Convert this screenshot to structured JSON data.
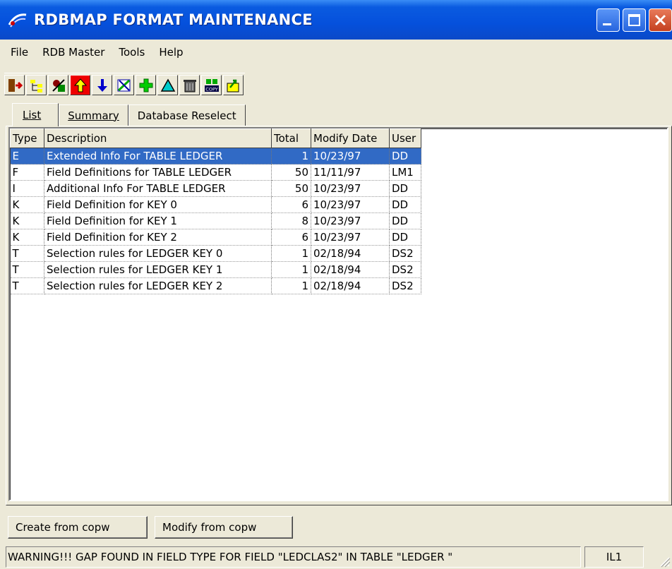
{
  "window": {
    "title": "RDBMAP FORMAT MAINTENANCE"
  },
  "menu": [
    "File",
    "RDB Master",
    "Tools",
    "Help"
  ],
  "toolbar": {
    "icons": [
      "exit-icon",
      "tree-icon",
      "wizard-icon",
      "move-up-icon",
      "move-down-icon",
      "edit-icon",
      "add-icon",
      "triangle-icon",
      "trash-icon",
      "copy-icon",
      "export-icon"
    ],
    "copy_label": "COPY"
  },
  "tabs": [
    {
      "label": "List",
      "active": true
    },
    {
      "label": "Summary",
      "active": false
    },
    {
      "label": "Database Reselect",
      "active": false
    }
  ],
  "table": {
    "columns": [
      "Type",
      "Description",
      "Total",
      "Modify Date",
      "User"
    ],
    "rows": [
      {
        "type": "E",
        "description": "Extended Info For TABLE LEDGER",
        "total": "1",
        "date": "10/23/97",
        "user": "DD",
        "selected": true
      },
      {
        "type": "F",
        "description": "Field Definitions for TABLE LEDGER",
        "total": "50",
        "date": "11/11/97",
        "user": "LM1"
      },
      {
        "type": "I",
        "description": "Additional Info For TABLE LEDGER",
        "total": "50",
        "date": "10/23/97",
        "user": "DD"
      },
      {
        "type": "K",
        "description": "Field Definition for KEY 0",
        "total": "6",
        "date": "10/23/97",
        "user": "DD"
      },
      {
        "type": "K",
        "description": "Field Definition for KEY 1",
        "total": "8",
        "date": "10/23/97",
        "user": "DD"
      },
      {
        "type": "K",
        "description": "Field Definition for KEY 2",
        "total": "6",
        "date": "10/23/97",
        "user": "DD"
      },
      {
        "type": "T",
        "description": "Selection rules for LEDGER   KEY 0",
        "total": "1",
        "date": "02/18/94",
        "user": "DS2"
      },
      {
        "type": "T",
        "description": "Selection rules for LEDGER   KEY 1",
        "total": "1",
        "date": "02/18/94",
        "user": "DS2"
      },
      {
        "type": "T",
        "description": "Selection rules for LEDGER   KEY 2",
        "total": "1",
        "date": "02/18/94",
        "user": "DS2"
      }
    ]
  },
  "buttons": {
    "create": "Create from copw",
    "modify": "Modify from copw"
  },
  "status": {
    "message": "WARNING!!!  GAP FOUND IN FIELD TYPE FOR FIELD \"LEDCLAS2\" IN TABLE \"LEDGER  \"",
    "code": "IL1"
  },
  "colors": {
    "titlebar": "#0550dc",
    "selection": "#316ac5",
    "face": "#ece9d8"
  }
}
